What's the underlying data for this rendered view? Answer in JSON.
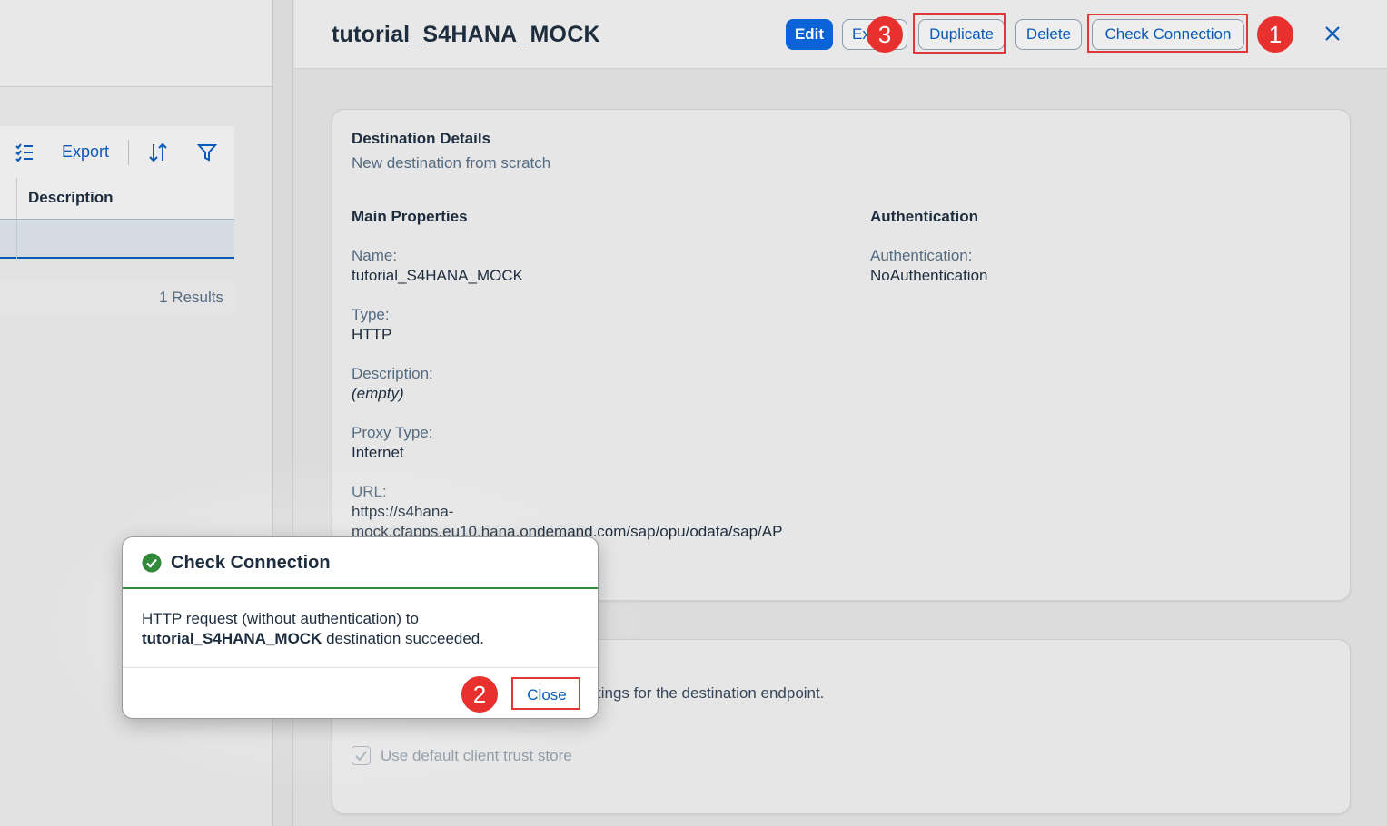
{
  "list": {
    "export_label": "Export",
    "column_description": "Description",
    "results": "1 Results"
  },
  "detail": {
    "title": "tutorial_S4HANA_MOCK",
    "buttons": {
      "edit": "Edit",
      "export": "Export",
      "duplicate": "Duplicate",
      "delete": "Delete",
      "check_connection": "Check Connection"
    },
    "section_title": "Destination Details",
    "section_subtitle": "New destination from scratch",
    "main_properties": {
      "heading": "Main Properties",
      "name_label": "Name:",
      "name_value": "tutorial_S4HANA_MOCK",
      "type_label": "Type:",
      "type_value": "HTTP",
      "description_label": "Description:",
      "description_value": "(empty)",
      "proxy_label": "Proxy Type:",
      "proxy_value": "Internet",
      "url_label": "URL:",
      "url_line1": "https://s4hana-",
      "url_line2": "mock.cfapps.eu10.hana.ondemand.com/sap/opu/odata/sap/AP"
    },
    "authentication": {
      "heading": "Authentication",
      "label": "Authentication:",
      "value": "NoAuthentication"
    },
    "trust": {
      "desc_fragment": "tings for the destination endpoint.",
      "checkbox_label": "Use default client trust store"
    }
  },
  "dialog": {
    "title": "Check Connection",
    "body_prefix": "HTTP request (without authentication) to",
    "body_bold": "tutorial_S4HANA_MOCK",
    "body_suffix": " destination succeeded.",
    "close_label": "Close"
  },
  "markers": {
    "one": "1",
    "two": "2",
    "three": "3"
  },
  "colors": {
    "accent": "#0a5bb8",
    "highlight": "#e03838",
    "marker": "#e8302f",
    "success": "#2f8a3a"
  },
  "icons": [
    "checklist-icon",
    "sort-icon",
    "filter-icon",
    "close-icon",
    "success-check-icon",
    "checkbox-check-icon"
  ]
}
